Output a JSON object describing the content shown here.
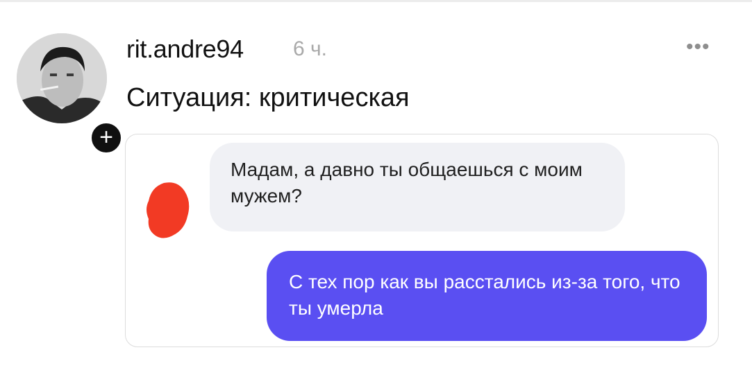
{
  "post": {
    "username": "rit.andre94",
    "time": "6 ч.",
    "text": "Ситуация: критическая",
    "more_label": "•••",
    "follow_label": "+"
  },
  "chat": {
    "incoming": "Мадам, а давно ты общаешься с моим мужем?",
    "outgoing": "С тех пор как вы расстались из-за того, что ты умерла"
  },
  "colors": {
    "outgoing_bubble": "#5a4ff2",
    "incoming_bubble": "#f0f1f5",
    "censor_blob": "#f23a24"
  }
}
